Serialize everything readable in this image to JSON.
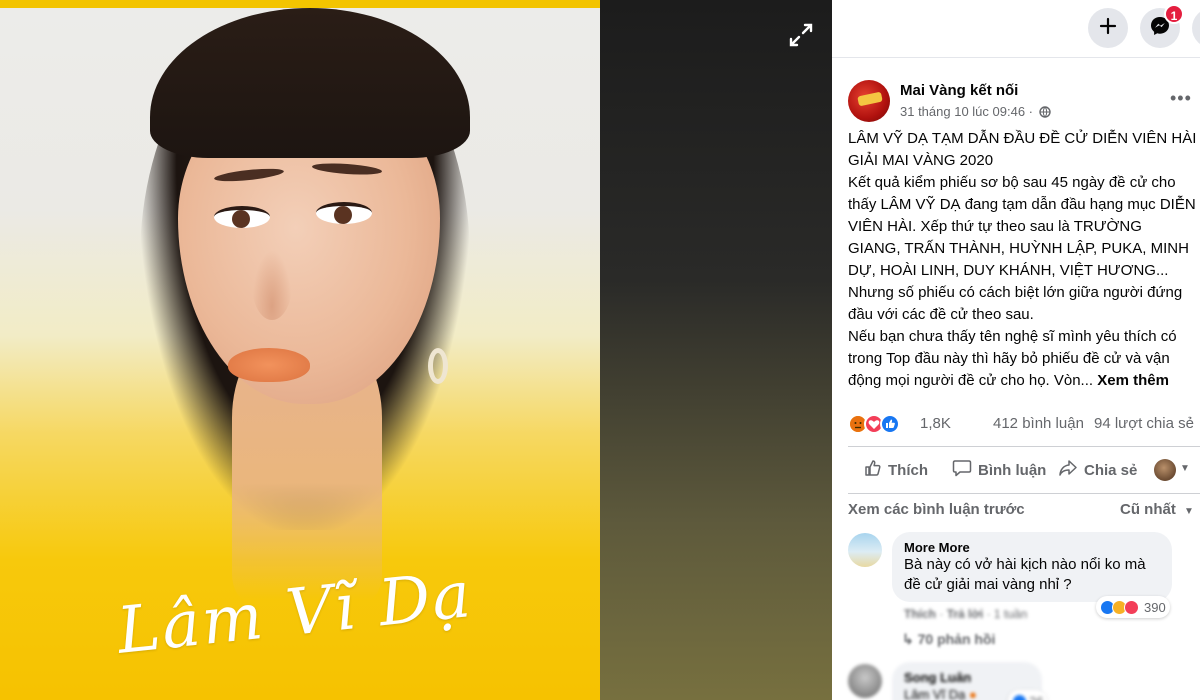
{
  "photo": {
    "signature": "Lâm Vĩ Dạ",
    "accent_color": "#f6c200"
  },
  "viewer": {
    "expand_icon": "expand-icon"
  },
  "topnav": {
    "create_icon": "plus-icon",
    "messenger_icon": "messenger-icon",
    "messenger_badge": "1"
  },
  "post": {
    "page_name": "Mai Vàng kết nối",
    "timestamp": "31 tháng 10 lúc 09:46 ·",
    "privacy_icon": "globe-icon",
    "paragraphs": [
      "LÂM VỸ DẠ TẠM DẪN ĐẦU ĐỀ CỬ DIỄN VIÊN HÀI GIẢI MAI VÀNG 2020",
      "Kết quả kiểm phiếu sơ bộ sau 45 ngày đề cử cho thấy LÂM VỸ DẠ đang tạm dẫn đầu hạng mục DIỄN VIÊN HÀI. Xếp thứ tự theo sau là TRƯỜNG GIANG, TRẤN THÀNH, HUỲNH LẬP, PUKA, MINH DỰ, HOÀI LINH, DUY KHÁNH, VIỆT HƯƠNG...",
      "Nhưng số phiếu có cách biệt lớn giữa người đứng đầu với các đề cử theo sau.",
      "Nếu bạn chưa thấy tên nghệ sĩ mình yêu thích có trong Top đầu này thì hãy bỏ phiếu đề cử và vận động mọi người đề cử cho họ. Vòn..."
    ],
    "see_more": "Xem thêm"
  },
  "stats": {
    "reactions": "1,8K",
    "comments": "412 bình luận",
    "shares": "94 lượt chia sẻ"
  },
  "actions": {
    "like": "Thích",
    "comment": "Bình luận",
    "share": "Chia sẻ"
  },
  "comments_header": {
    "previous": "Xem các bình luận trước",
    "sort": "Cũ nhất"
  },
  "comments": [
    {
      "author": "More More",
      "text_line1": "Bà này có vở hài kịch nào nổi ko mà",
      "text_line2": "đề cử giải mai vàng nhỉ ?",
      "like": "Thích",
      "reply": "Trả lời",
      "time": "· 1 tuần",
      "reaction_count": "390",
      "replies": "↳ 70 phản hồi"
    },
    {
      "author": "Song Luân",
      "text": "Lâm Vĩ Dạ",
      "reaction_count": "26"
    }
  ],
  "colors": {
    "like_blue": "#1877f2",
    "love_red": "#f33e58",
    "haha_yellow": "#f7b125",
    "text_gray": "#65676b"
  }
}
